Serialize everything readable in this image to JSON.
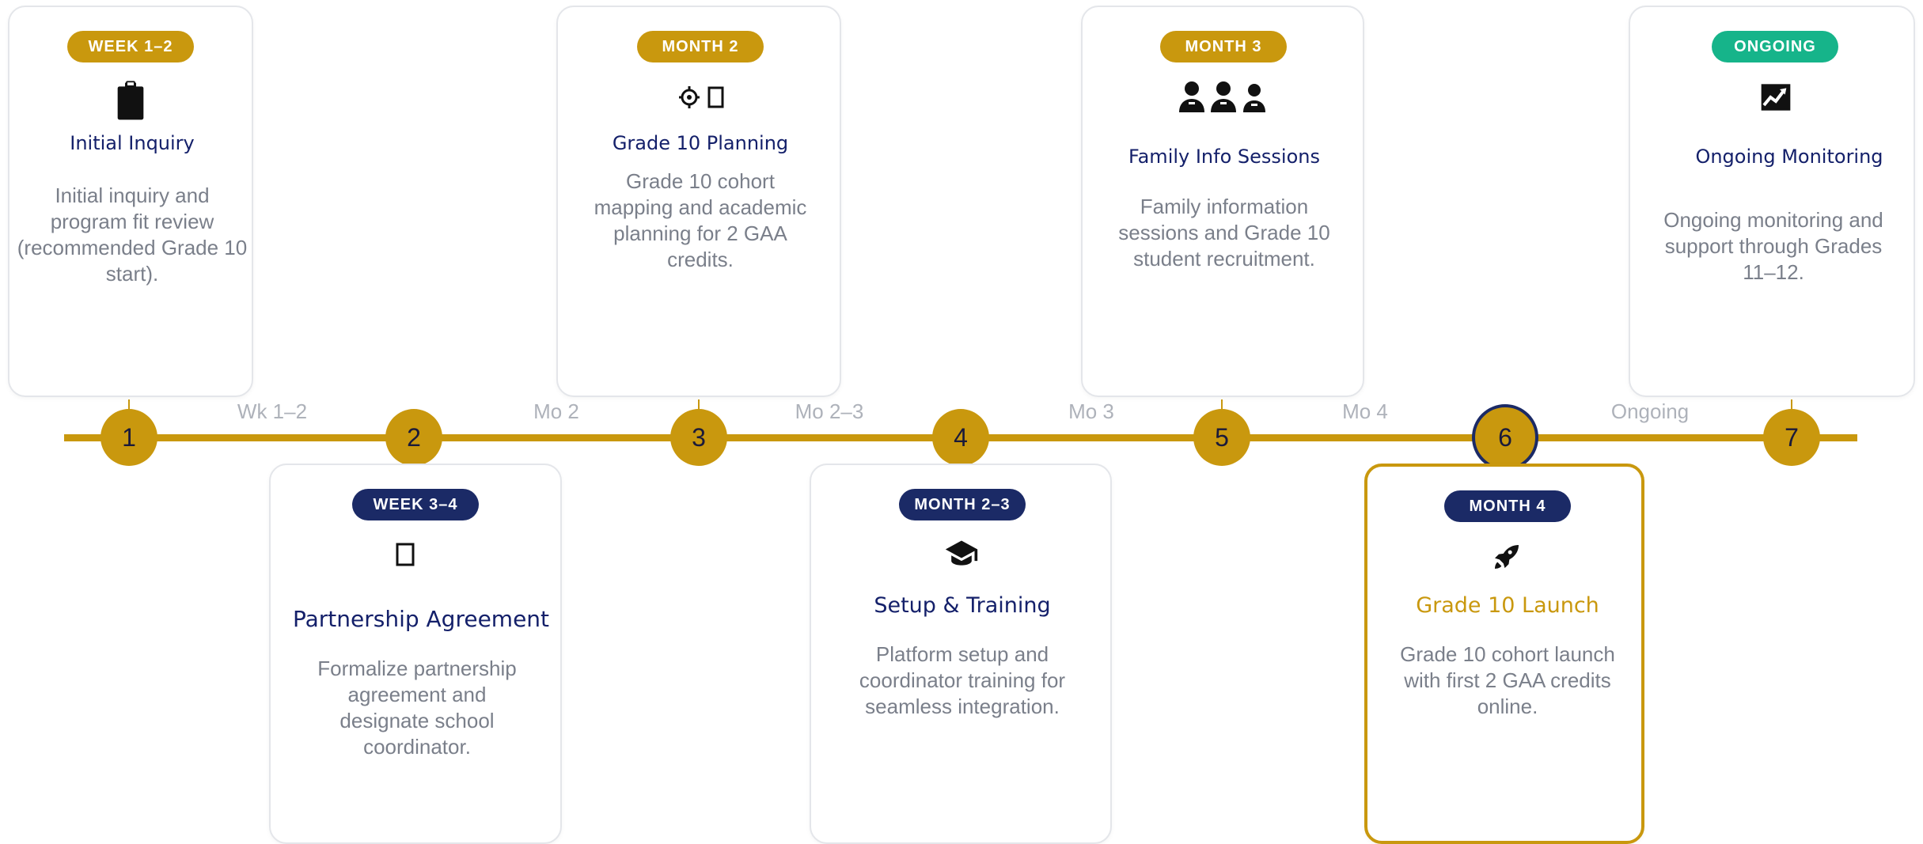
{
  "steps": [
    {
      "number": "1",
      "badge": "WEEK 1–2",
      "icon": "clipboard-icon",
      "title": "Initial Inquiry",
      "description": "Initial inquiry and program fit review (recommended Grade 10 start)."
    },
    {
      "number": "2",
      "badge": "WEEK 3–4",
      "icon": "document-icon",
      "title": "Partnership Agreement",
      "description": "Formalize partnership agreement and designate school coordinator."
    },
    {
      "number": "3",
      "badge": "MONTH 2",
      "icon": "target-icon",
      "title": "Grade 10 Planning",
      "description": "Grade 10 cohort mapping and academic planning for 2 GAA credits."
    },
    {
      "number": "4",
      "badge": "MONTH 2–3",
      "icon": "graduation-cap-icon",
      "title": "Setup & Training",
      "description": "Platform setup and coordinator training for seamless integration."
    },
    {
      "number": "5",
      "badge": "MONTH 3",
      "icon": "family-icon",
      "title": "Family Info Sessions",
      "description": "Family information sessions and Grade 10 student recruitment."
    },
    {
      "number": "6",
      "badge": "MONTH 4",
      "icon": "rocket-icon",
      "title": "Grade 10 Launch",
      "description": "Grade 10 cohort launch with first 2 GAA credits online.",
      "highlighted": true
    },
    {
      "number": "7",
      "badge": "ONGOING",
      "icon": "chart-icon",
      "title": "Ongoing Monitoring",
      "description": "Ongoing monitoring and support through Grades 11–12."
    }
  ],
  "segments": [
    "Wk 1–2",
    "Mo 2",
    "Mo 2–3",
    "Mo 3",
    "Mo 4",
    "Ongoing"
  ],
  "colors": {
    "gold": "#c9980e",
    "navy": "#1b2a66",
    "teal": "#16b48a",
    "title": "#14206a",
    "text": "#7a7f8a",
    "segment": "#aeb2ba"
  }
}
